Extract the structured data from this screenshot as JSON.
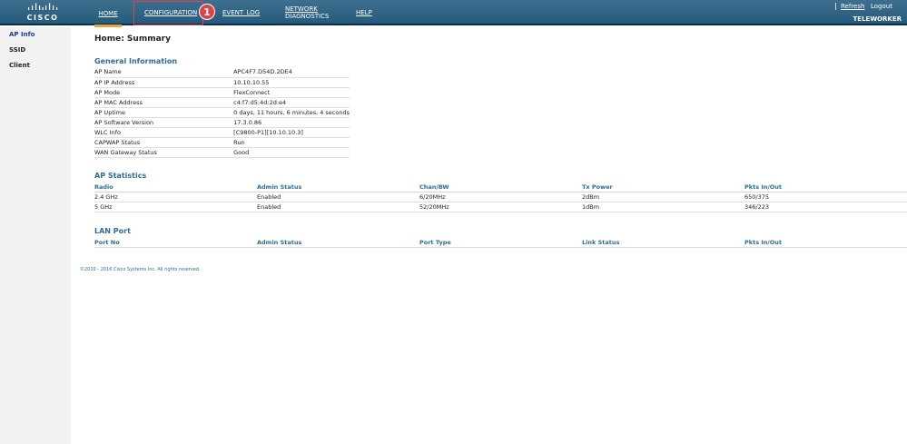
{
  "header": {
    "logo_text": "CISCO",
    "nav": {
      "home": "HOME",
      "configuration": "CONFIGURATION",
      "event_log": "EVENT_LOG",
      "network_line1": "NETWORK",
      "network_line2": "DIAGNOSTICS",
      "help": "HELP"
    },
    "refresh": "Refresh",
    "logout": "Logout",
    "mode": "TELEWORKER",
    "step_badge": "1",
    "accent_color": "#e0424a"
  },
  "sidebar": {
    "items": [
      {
        "label": "AP Info"
      },
      {
        "label": "SSID"
      },
      {
        "label": "Client"
      }
    ]
  },
  "main": {
    "title": "Home: Summary",
    "general_info": {
      "heading": "General Information",
      "rows": [
        {
          "k": "AP Name",
          "v": "APC4F7.D54D.2DE4"
        },
        {
          "k": "AP IP Address",
          "v": "10.10.10.55"
        },
        {
          "k": "AP Mode",
          "v": "FlexConnect"
        },
        {
          "k": "AP MAC Address",
          "v": "c4:f7:d5:4d:2d:e4"
        },
        {
          "k": "AP Uptime",
          "v": "0 days, 11 hours, 6 minutes, 4 seconds"
        },
        {
          "k": "AP Software Version",
          "v": "17.3.0.86"
        },
        {
          "k": "WLC Info",
          "v": "[C9800-P1][10.10.10.3]"
        },
        {
          "k": "CAPWAP Status",
          "v": "Run"
        },
        {
          "k": "WAN Gateway Status",
          "v": "Good"
        }
      ]
    },
    "ap_statistics": {
      "heading": "AP Statistics",
      "columns": [
        "Radio",
        "Admin Status",
        "Chan/BW",
        "Tx Power",
        "Pkts In/Out"
      ],
      "rows": [
        [
          "2.4 GHz",
          "Enabled",
          "6/20MHz",
          "2dBm",
          "650/375"
        ],
        [
          "5 GHz",
          "Enabled",
          "52/20MHz",
          "1dBm",
          "346/223"
        ]
      ]
    },
    "lan_port": {
      "heading": "LAN Port",
      "columns": [
        "Port No",
        "Admin Status",
        "Port Type",
        "Link Status",
        "Pkts In/Out"
      ]
    }
  },
  "footer": {
    "copyright": "©2010 - 2016 Cisco Systems Inc. All rights reserved."
  }
}
